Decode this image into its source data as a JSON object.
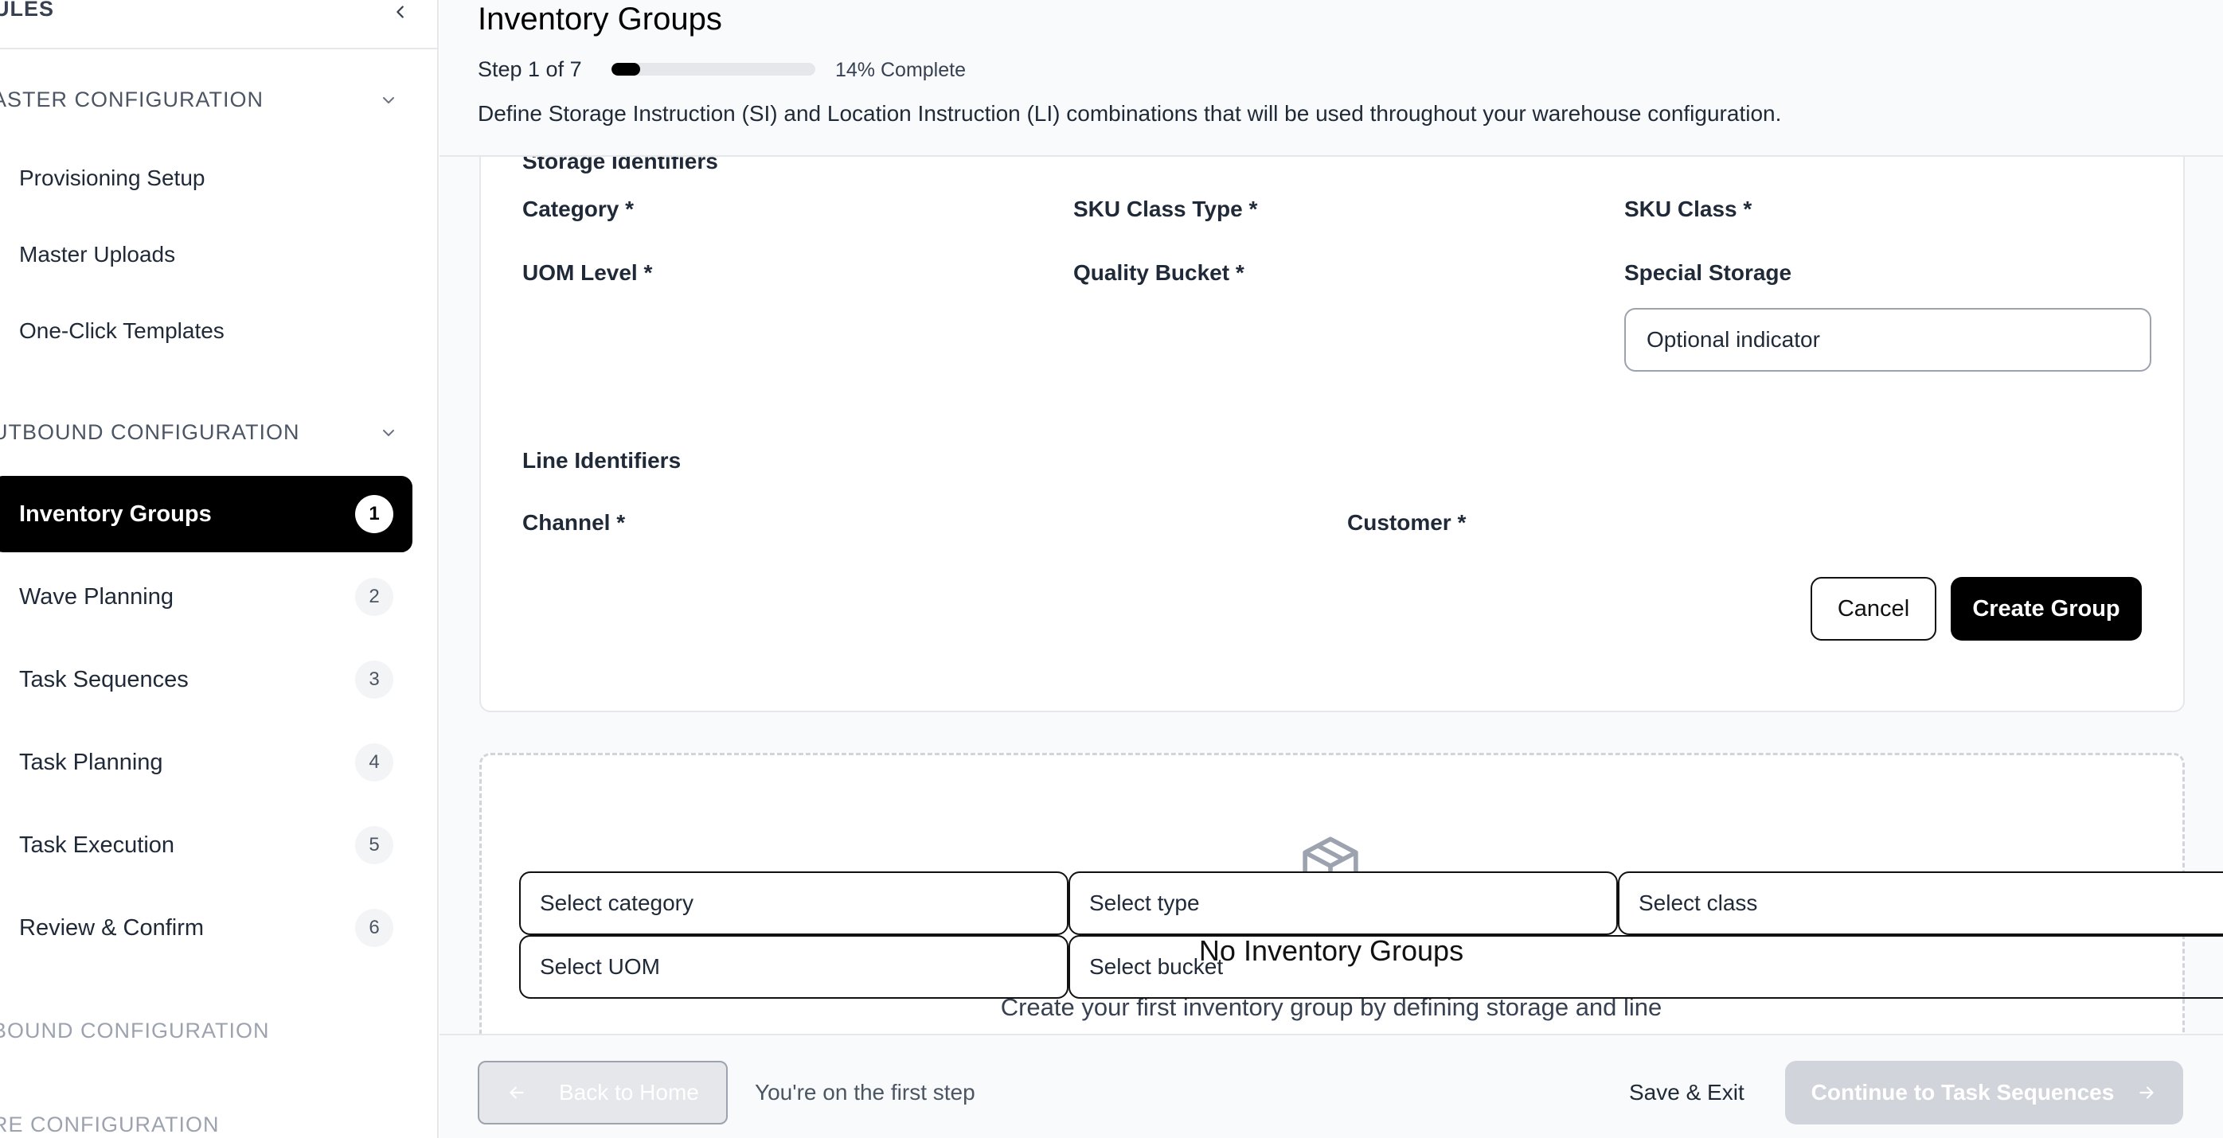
{
  "sidebar": {
    "header": "ULES",
    "sections": {
      "master": "ASTER CONFIGURATION",
      "outbound": "UTBOUND CONFIGURATION",
      "inbound": "BOUND CONFIGURATION",
      "core": "RE CONFIGURATION"
    },
    "master_items": [
      "Provisioning Setup",
      "Master Uploads",
      "One-Click Templates"
    ],
    "steps": [
      {
        "label": "Inventory Groups",
        "num": "1"
      },
      {
        "label": "Wave Planning",
        "num": "2"
      },
      {
        "label": "Task Sequences",
        "num": "3"
      },
      {
        "label": "Task Planning",
        "num": "4"
      },
      {
        "label": "Task Execution",
        "num": "5"
      },
      {
        "label": "Review & Confirm",
        "num": "6"
      }
    ]
  },
  "header": {
    "title": "Inventory Groups",
    "step": "Step 1 of 7",
    "progress_fraction": 0.14,
    "percent_text": "14% Complete",
    "description": "Define Storage Instruction (SI) and Location Instruction (LI) combinations that will be used throughout your warehouse configuration."
  },
  "form": {
    "storage_title": "Storage Identifiers",
    "category_label": "Category *",
    "sku_class_type_label": "SKU Class Type *",
    "sku_class_label": "SKU Class *",
    "uom_level_label": "UOM Level *",
    "quality_bucket_label": "Quality Bucket *",
    "special_storage_label": "Special Storage",
    "special_storage_placeholder": "Optional indicator",
    "line_title": "Line Identifiers",
    "channel_label": "Channel *",
    "customer_label": "Customer *",
    "cancel": "Cancel",
    "create": "Create Group"
  },
  "selects": {
    "category": "Select category",
    "type": "Select type",
    "class": "Select class",
    "uom": "Select UOM",
    "bucket": "Select bucket"
  },
  "empty": {
    "title": "No Inventory Groups",
    "subtitle": "Create your first inventory group by defining storage and line"
  },
  "footer": {
    "back": "Back to Home",
    "note": "You're on the first step",
    "save_exit": "Save & Exit",
    "continue": "Continue to Task Sequences"
  }
}
